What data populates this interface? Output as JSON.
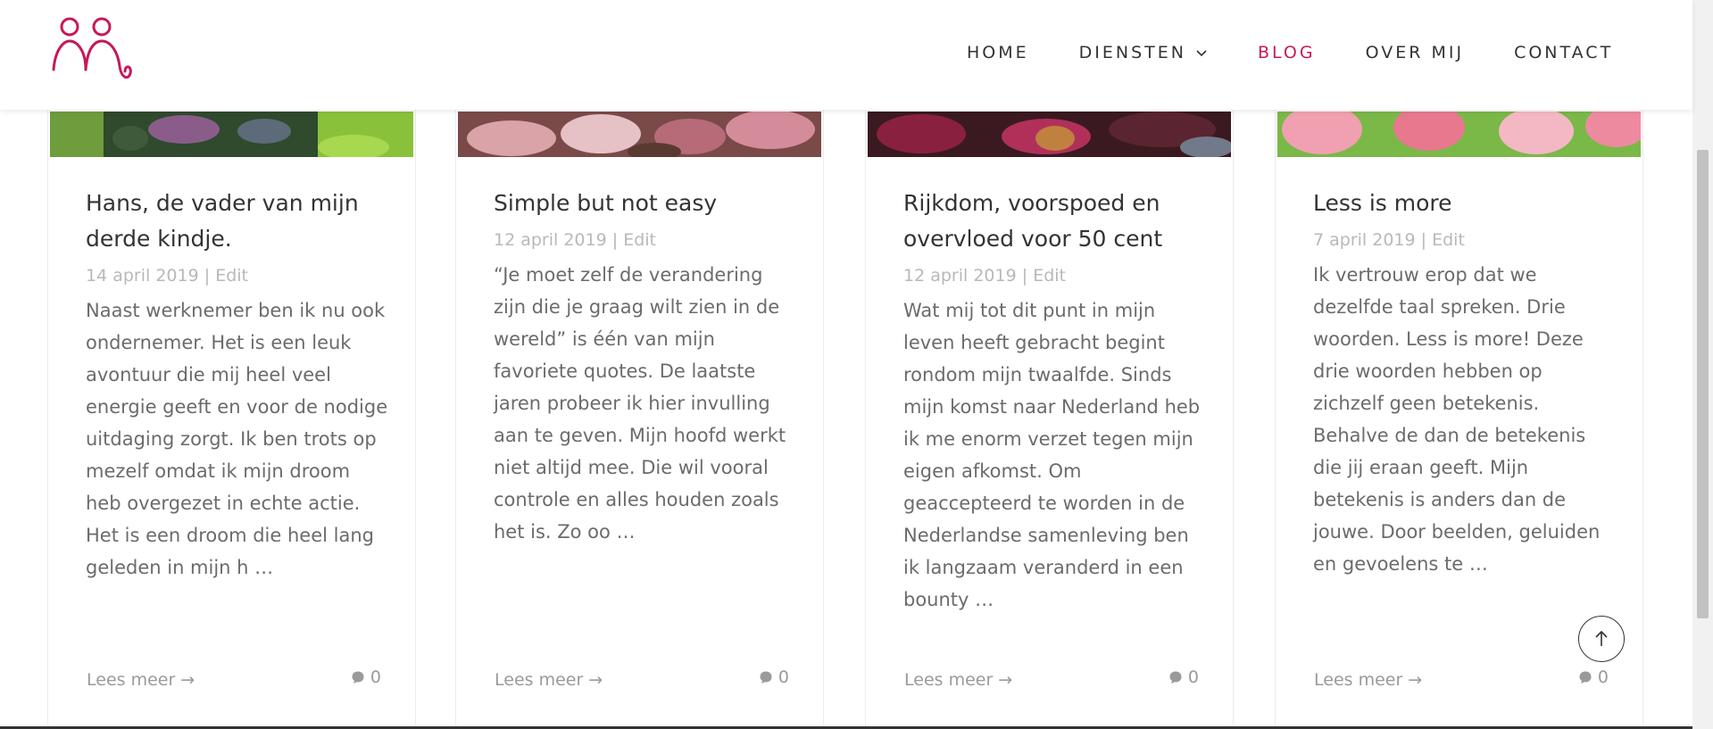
{
  "nav": {
    "items": [
      {
        "label": "HOME"
      },
      {
        "label": "DIENSTEN"
      },
      {
        "label": "BLOG"
      },
      {
        "label": "OVER MIJ"
      },
      {
        "label": "CONTACT"
      }
    ],
    "active": "BLOG",
    "accent_color": "#c7185a"
  },
  "posts": [
    {
      "title": "Hans, de vader van mijn derde kindje.",
      "date": "14 april 2019",
      "edit": "Edit",
      "excerpt": "Naast werknemer ben ik nu ook ondernemer. Het is een leuk avontuur die mij heel veel energie geeft en voor de nodige uitdaging zorgt. Ik ben trots op mezelf omdat ik mijn droom heb overgezet in echte actie. Het is een droom die heel lang geleden in mijn h …",
      "read_more": "Lees meer →",
      "comments": "0"
    },
    {
      "title": "Simple but not easy",
      "date": "12 april 2019",
      "edit": "Edit",
      "excerpt": "“Je moet zelf de verandering zijn die je graag wilt zien in de wereld” is één van mijn favoriete quotes. De laatste jaren probeer ik hier invulling aan te geven. Mijn hoofd werkt niet altijd mee. Die wil vooral controle en alles houden zoals het is. Zo oo …",
      "read_more": "Lees meer →",
      "comments": "0"
    },
    {
      "title": "Rijkdom, voorspoed en overvloed voor 50 cent",
      "date": "12 april 2019",
      "edit": "Edit",
      "excerpt": "Wat mij tot dit punt in mijn leven heeft gebracht begint rondom mijn twaalfde. Sinds mijn komst naar Nederland heb ik me enorm verzet tegen mijn eigen afkomst. Om geaccepteerd te worden in de Nederlandse samenleving ben ik langzaam veranderd in een bounty …",
      "read_more": "Lees meer →",
      "comments": "0"
    },
    {
      "title": "Less is more",
      "date": "7 april 2019",
      "edit": "Edit",
      "excerpt": "Ik vertrouw erop dat we dezelfde taal spreken. Drie woorden. Less is more! Deze drie woorden hebben op zichzelf geen betekenis. Behalve de dan de betekenis die jij eraan geeft. Mijn betekenis is anders dan de jouwe. Door beelden, geluiden en gevoelens te …",
      "read_more": "Lees meer →",
      "comments": "0"
    }
  ],
  "icons": {
    "logo": "two-figures-logo",
    "dropdown": "chevron-down-icon",
    "comment": "comment-bubble-icon",
    "back_to_top": "arrow-up-icon"
  }
}
